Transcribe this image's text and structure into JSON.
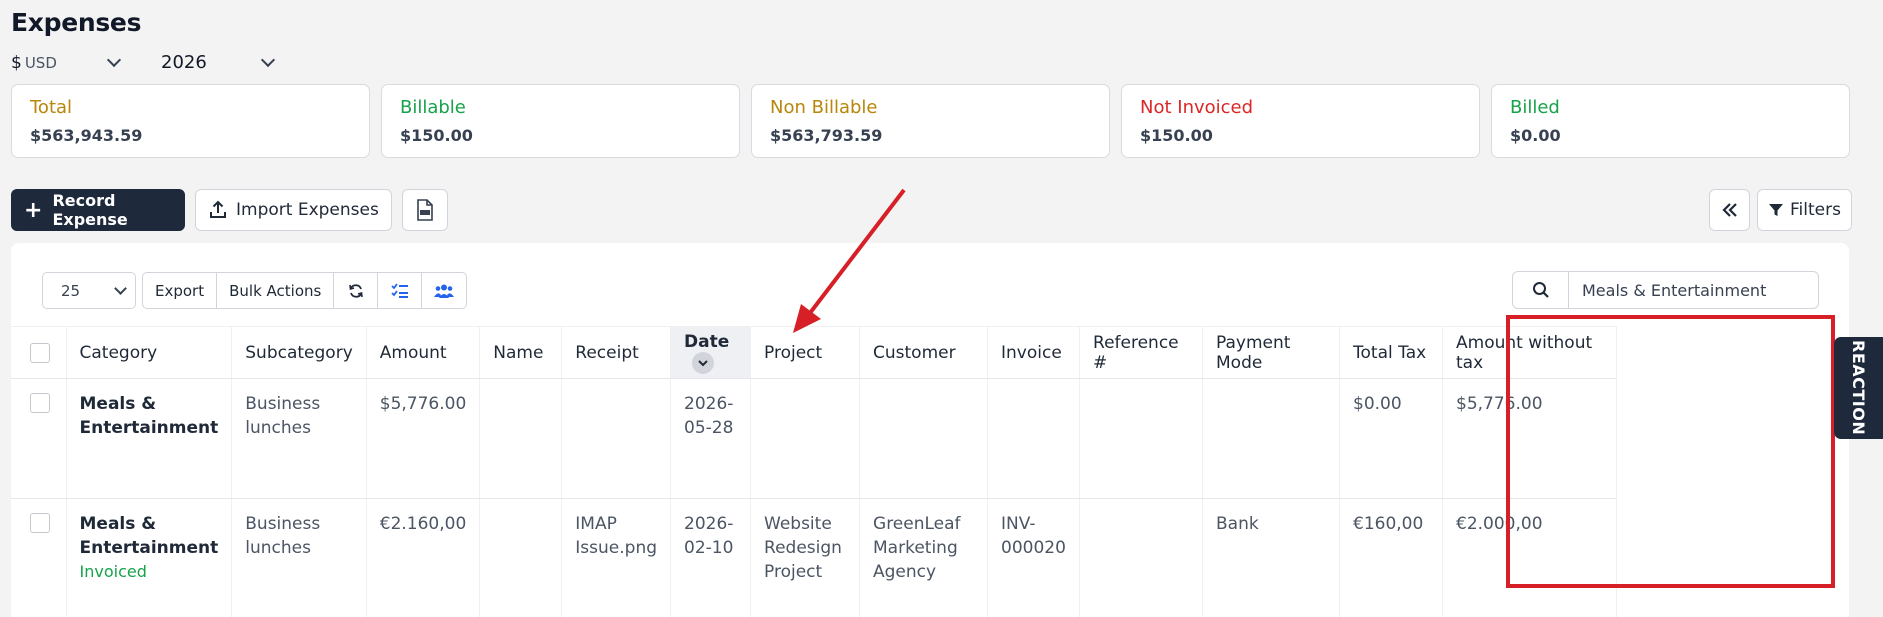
{
  "page": {
    "title": "Expenses"
  },
  "filters": {
    "currency_symbol": "$",
    "currency_code": "USD",
    "year": "2026"
  },
  "summary_cards": [
    {
      "label": "Total",
      "value": "$563,943.59",
      "color": "#b7860b"
    },
    {
      "label": "Billable",
      "value": "$150.00",
      "color": "#16a34a"
    },
    {
      "label": "Non Billable",
      "value": "$563,793.59",
      "color": "#b7860b"
    },
    {
      "label": "Not Invoiced",
      "value": "$150.00",
      "color": "#dc2626"
    },
    {
      "label": "Billed",
      "value": "$0.00",
      "color": "#16a34a"
    }
  ],
  "toolbar": {
    "record_label": "Record Expense",
    "import_label": "Import Expenses",
    "filters_label": "Filters"
  },
  "table_controls": {
    "page_size": "25",
    "export_label": "Export",
    "bulk_label": "Bulk Actions"
  },
  "search": {
    "value": "Meals & Entertainment"
  },
  "table": {
    "columns": [
      "Category",
      "Subcategory",
      "Amount",
      "Name",
      "Receipt",
      "Date",
      "Project",
      "Customer",
      "Invoice",
      "Reference #",
      "Payment Mode",
      "Total Tax",
      "Amount without tax"
    ],
    "rows": [
      {
        "category": "Meals & Entertainment",
        "status": "",
        "subcategory": "Business lunches",
        "amount": "$5,776.00",
        "name": "",
        "receipt": "",
        "date": "2026-05-28",
        "project": "",
        "customer": "",
        "invoice": "",
        "reference": "",
        "payment_mode": "",
        "total_tax": "$0.00",
        "amount_without_tax": "$5,776.00"
      },
      {
        "category": "Meals & Entertainment",
        "status": "Invoiced",
        "subcategory": "Business lunches",
        "amount": "€2.160,00",
        "name": "",
        "receipt": "IMAP Issue.png",
        "date": "2026-02-10",
        "project": "Website Redesign Project",
        "customer": "GreenLeaf Marketing Agency",
        "invoice": "INV-000020",
        "reference": "",
        "payment_mode": "Bank",
        "total_tax": "€160,00",
        "amount_without_tax": "€2.000,00"
      }
    ]
  },
  "side_tab": {
    "label": "REACTION"
  },
  "colors": {
    "primary": "#1e293b",
    "annotation": "#d61f26",
    "status_invoiced": "#16a34a"
  }
}
